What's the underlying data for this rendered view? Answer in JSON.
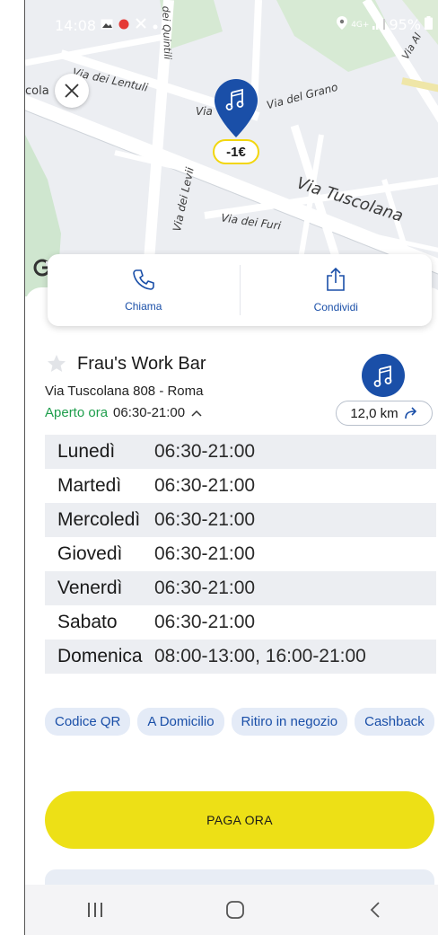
{
  "status_bar": {
    "time": "14:08",
    "battery": "95%",
    "network": "4G+"
  },
  "map": {
    "streets": [
      "Via dei Lentuli",
      "Via del Grano",
      "Via Tuscolana",
      "Via dei Levii",
      "Via dei Furi",
      "Via",
      "cola",
      "dei Quintili",
      "Via Al"
    ],
    "pin_badge": "-1€"
  },
  "actions": {
    "call_label": "Chiama",
    "share_label": "Condividi"
  },
  "store": {
    "name": "Frau's Work Bar",
    "address": "Via Tuscolana 808 - Roma",
    "open_status": "Aperto ora",
    "open_hours": "06:30-21:00",
    "distance": "12,0 km"
  },
  "hours": [
    {
      "day": "Lunedì",
      "time": "06:30-21:00"
    },
    {
      "day": "Martedì",
      "time": "06:30-21:00"
    },
    {
      "day": "Mercoledì",
      "time": "06:30-21:00"
    },
    {
      "day": "Giovedì",
      "time": "06:30-21:00"
    },
    {
      "day": "Venerdì",
      "time": "06:30-21:00"
    },
    {
      "day": "Sabato",
      "time": "06:30-21:00"
    },
    {
      "day": "Domenica",
      "time": "08:00-13:00, 16:00-21:00"
    }
  ],
  "tags": [
    "Codice QR",
    "A Domicilio",
    "Ritiro in negozio",
    "Cashback"
  ],
  "pay_button": "PAGA ORA",
  "colors": {
    "accent_blue": "#1a4fa8",
    "open_green": "#1e9e4c",
    "pay_yellow": "#ede016"
  }
}
